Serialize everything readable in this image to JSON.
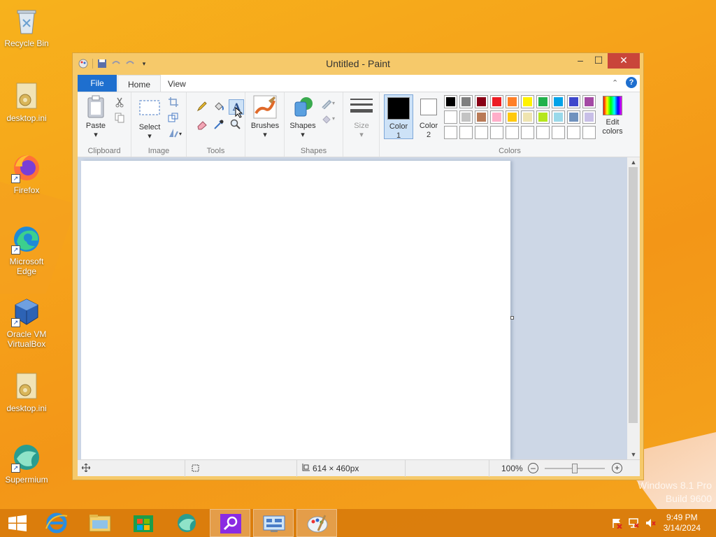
{
  "desktop": {
    "icons": [
      {
        "label": "Recycle Bin"
      },
      {
        "label": "desktop.ini"
      },
      {
        "label": "Firefox"
      },
      {
        "label": "Microsoft Edge"
      },
      {
        "label": "Oracle VM VirtualBox"
      },
      {
        "label": "desktop.ini"
      },
      {
        "label": "Supermium"
      }
    ],
    "watermark": {
      "line1": "Windows 8.1 Pro",
      "line2": "Build 9600"
    }
  },
  "window": {
    "title": "Untitled - Paint",
    "controls": {
      "minimize": "–",
      "maximize": "☐",
      "close": "✕"
    },
    "menu": {
      "file": "File",
      "home": "Home",
      "view": "View",
      "help": "?"
    },
    "ribbon": {
      "clipboard": {
        "label": "Clipboard",
        "paste": "Paste"
      },
      "image": {
        "label": "Image",
        "select": "Select"
      },
      "tools": {
        "label": "Tools"
      },
      "brushes": {
        "label": "Brushes"
      },
      "shapes": {
        "label": "Shapes",
        "button": "Shapes"
      },
      "size": {
        "label": "Size"
      },
      "colors": {
        "label": "Colors",
        "color1": "Color 1",
        "color2": "Color 2",
        "edit": "Edit colors",
        "color1_value": "#000000",
        "color2_value": "#ffffff",
        "palette_row1": [
          "#000000",
          "#7f7f7f",
          "#880015",
          "#ed1c24",
          "#ff7f27",
          "#fff200",
          "#22b14c",
          "#00a2e8",
          "#3f48cc",
          "#a349a4"
        ],
        "palette_row2": [
          "#ffffff",
          "#c3c3c3",
          "#b97a57",
          "#ffaec9",
          "#ffc90e",
          "#efe4b0",
          "#b5e61d",
          "#99d9ea",
          "#7092be",
          "#c8bfe7"
        ],
        "palette_row3": [
          "#ffffff",
          "#ffffff",
          "#ffffff",
          "#ffffff",
          "#ffffff",
          "#ffffff",
          "#ffffff",
          "#ffffff",
          "#ffffff",
          "#ffffff"
        ]
      }
    },
    "status": {
      "dimensions": "614 × 460px",
      "zoom": "100%"
    }
  },
  "taskbar": {
    "time": "9:49 PM",
    "date": "3/14/2024"
  }
}
